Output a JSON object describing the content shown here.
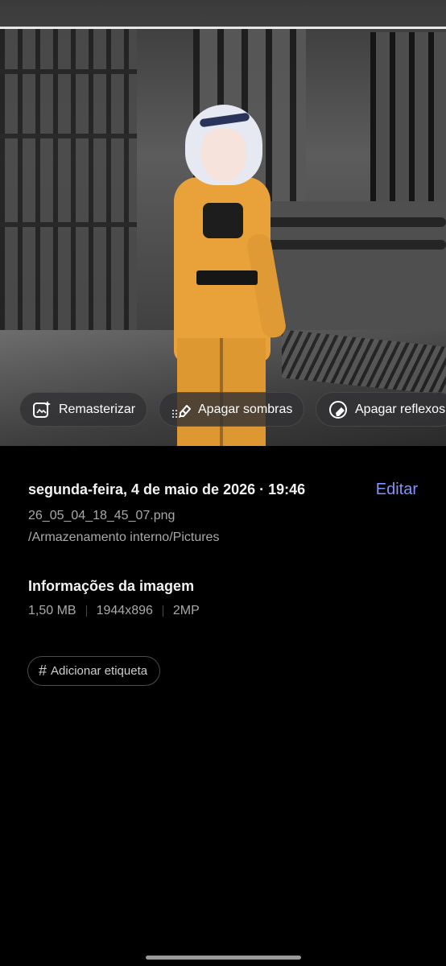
{
  "photo": {
    "chips": [
      {
        "icon": "sparkle-photo-icon",
        "label": "Remasterizar"
      },
      {
        "icon": "eraser-shadow-icon",
        "label": "Apagar sombras"
      },
      {
        "icon": "eraser-reflection-icon",
        "label": "Apagar reflexos"
      }
    ]
  },
  "details": {
    "datetime": "segunda-feira, 4 de maio de 2026 · 19:46",
    "edit_label": "Editar",
    "filename": "26_05_04_18_45_07.png",
    "path": "/Armazenamento interno/Pictures"
  },
  "image_info": {
    "title": "Informações da imagem",
    "size": "1,50 MB",
    "resolution": "1944x896",
    "megapixels": "2MP"
  },
  "tag": {
    "symbol": "#",
    "label": "Adicionar etiqueta"
  },
  "colors": {
    "accent": "#7f95ff",
    "background": "#000000",
    "secondary_text": "#a9a9a9"
  }
}
